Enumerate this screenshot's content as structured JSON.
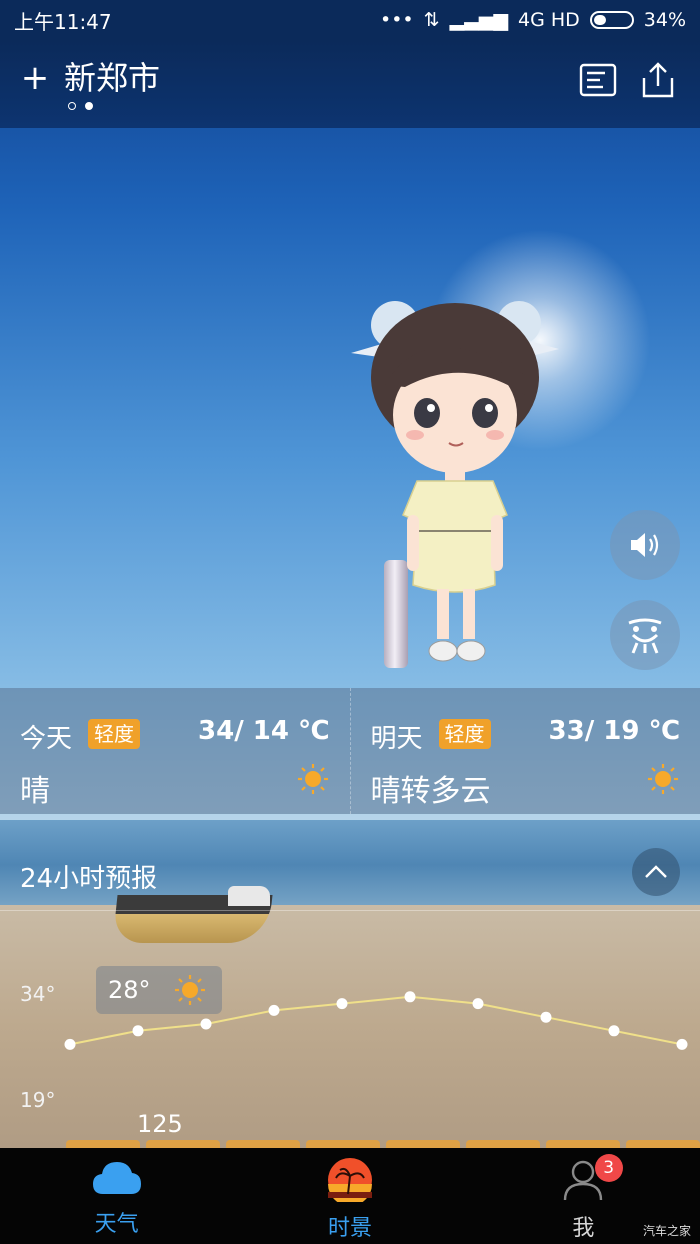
{
  "status_bar": {
    "time": "上午11:47",
    "signal_text": "4G HD",
    "battery": "34%",
    "battery_level": 0.34
  },
  "header": {
    "add_label": "+",
    "city": "新郑市",
    "page_count": 2,
    "active_page": 1
  },
  "today": {
    "label": "今天",
    "aqi": "轻度",
    "temp": "34/ 14 ℃",
    "condition": "晴",
    "icon": "sun-icon"
  },
  "tomorrow": {
    "label": "明天",
    "aqi": "轻度",
    "temp": "33/ 19 ℃",
    "condition": "晴转多云",
    "icon": "sun-icon"
  },
  "forecast": {
    "title": "24小时预报",
    "axis_high": "34°",
    "axis_low": "19°",
    "tooltip_temp": "28°",
    "aqi_value": "125"
  },
  "chart_data": {
    "type": "line",
    "series": [
      {
        "values": [
          26,
          28,
          29,
          31,
          32,
          33,
          32,
          30,
          28,
          26
        ]
      }
    ],
    "ylim": [
      19,
      34
    ]
  },
  "nav": {
    "weather": "天气",
    "scene": "时景",
    "me": "我",
    "badge": "3"
  },
  "colors": {
    "accent": "#3aa0f0",
    "aqi_badge": "#f0a12a",
    "notification": "#f04848"
  },
  "watermark": "汽车之家"
}
